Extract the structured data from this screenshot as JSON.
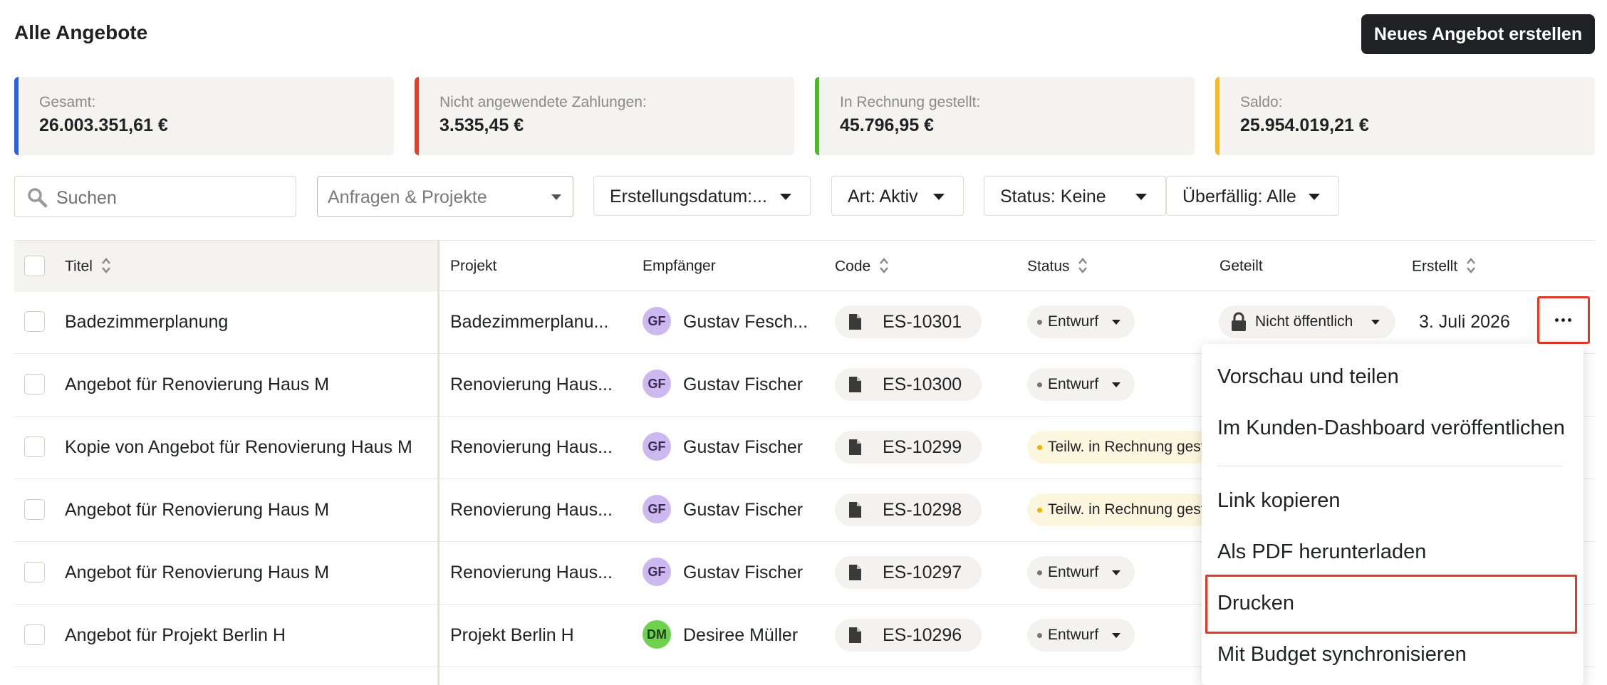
{
  "header": {
    "title": "Alle Angebote",
    "new_button": "Neues Angebot erstellen"
  },
  "stats": [
    {
      "label": "Gesamt:",
      "value": "26.003.351,61 €",
      "color": "#2563eb"
    },
    {
      "label": "Nicht angewendete Zahlungen:",
      "value": "3.535,45 €",
      "color": "#e0402e"
    },
    {
      "label": "In Rechnung gestellt:",
      "value": "45.796,95 €",
      "color": "#4cb82a"
    },
    {
      "label": "Saldo:",
      "value": "25.954.019,21 €",
      "color": "#f5b829"
    }
  ],
  "filters": {
    "search_placeholder": "Suchen",
    "project_select_placeholder": "Anfragen & Projekte",
    "date": "Erstellungsdatum:...",
    "type": "Art: Aktiv",
    "status": "Status: Keine",
    "overdue": "Überfällig: Alle"
  },
  "table": {
    "columns": {
      "title": "Titel",
      "project": "Projekt",
      "recipient": "Empfänger",
      "code": "Code",
      "status": "Status",
      "shared": "Geteilt",
      "created": "Erstellt"
    },
    "rows": [
      {
        "title": "Badezimmerplanung",
        "project": "Badezimmerplanu...",
        "initials": "GF",
        "avatar_color": "#cdb8ef",
        "recipient": "Gustav Fesch...",
        "code": "ES-10301",
        "status": "Entwurf",
        "status_kind": "draft",
        "shared": "Nicht öffentlich",
        "created": "3. Juli 2026"
      },
      {
        "title": "Angebot für Renovierung Haus M",
        "project": "Renovierung Haus...",
        "initials": "GF",
        "avatar_color": "#cdb8ef",
        "recipient": "Gustav Fischer",
        "code": "ES-10300",
        "status": "Entwurf",
        "status_kind": "draft"
      },
      {
        "title": "Kopie von Angebot für Renovierung Haus M",
        "project": "Renovierung Haus...",
        "initials": "GF",
        "avatar_color": "#cdb8ef",
        "recipient": "Gustav Fischer",
        "code": "ES-10299",
        "status": "Teilw. in Rechnung gestellt",
        "status_kind": "partial"
      },
      {
        "title": "Angebot für Renovierung Haus M",
        "project": "Renovierung Haus...",
        "initials": "GF",
        "avatar_color": "#cdb8ef",
        "recipient": "Gustav Fischer",
        "code": "ES-10298",
        "status": "Teilw. in Rechnung gestellt",
        "status_kind": "partial"
      },
      {
        "title": "Angebot für Renovierung Haus M",
        "project": "Renovierung Haus...",
        "initials": "GF",
        "avatar_color": "#cdb8ef",
        "recipient": "Gustav Fischer",
        "code": "ES-10297",
        "status": "Entwurf",
        "status_kind": "draft"
      },
      {
        "title": "Angebot für Projekt Berlin H",
        "project": "Projekt Berlin H",
        "initials": "DM",
        "avatar_color": "#6fd24f",
        "recipient": "Desiree Müller",
        "code": "ES-10296",
        "status": "Entwurf",
        "status_kind": "draft"
      }
    ]
  },
  "context_menu": {
    "items": [
      "Vorschau und teilen",
      "Im Kunden-Dashboard veröffentlichen",
      "Link kopieren",
      "Als PDF herunterladen",
      "Drucken",
      "Mit Budget synchronisieren"
    ],
    "highlighted": "Drucken"
  },
  "colors": {
    "highlight_border": "#e0382b",
    "primary_button": "#1f2124"
  }
}
